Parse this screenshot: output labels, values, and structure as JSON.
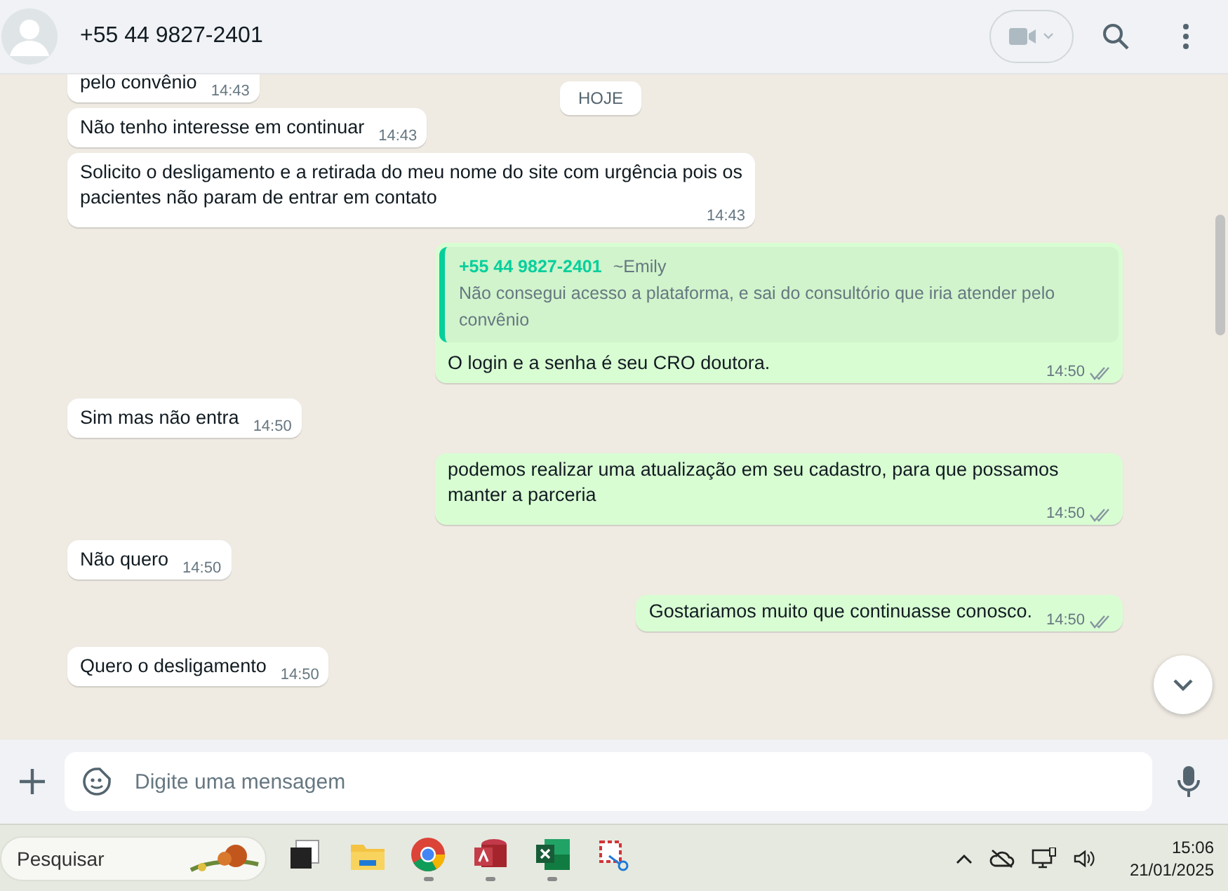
{
  "chat_header": {
    "contact_name": "+55 44 9827-2401"
  },
  "date_chip": "HOJE",
  "messages": [
    {
      "outgoing": false,
      "text": "pelo convênio",
      "time": "14:43"
    },
    {
      "outgoing": false,
      "text": "Não tenho interesse em continuar",
      "time": "14:43"
    },
    {
      "outgoing": false,
      "text": "Solicito o desligamento e a retirada do meu nome do site com urgência pois os pacientes não param de entrar em contato",
      "time": "14:43"
    },
    {
      "outgoing": true,
      "quoted": {
        "author": "+55 44 9827-2401",
        "author_name": "~Emily",
        "text": "Não consegui acesso a plataforma, e sai do consultório que iria atender pelo convênio"
      },
      "text": "O login e a senha é seu CRO doutora.",
      "time": "14:50",
      "read": false
    },
    {
      "outgoing": false,
      "text": "Sim mas não entra",
      "time": "14:50"
    },
    {
      "outgoing": true,
      "text": "podemos realizar uma atualização em seu cadastro, para que possamos manter a parceria",
      "time": "14:50",
      "read": false
    },
    {
      "outgoing": false,
      "text": "Não quero",
      "time": "14:50"
    },
    {
      "outgoing": true,
      "text": "Gostariamos muito que continuasse conosco.",
      "time": "14:50",
      "read": false
    },
    {
      "outgoing": false,
      "text": "Quero o desligamento",
      "time": "14:50"
    }
  ],
  "composer": {
    "placeholder": "Digite uma mensagem"
  },
  "taskbar": {
    "search_placeholder": "Pesquisar",
    "apps": [
      {
        "kind": "taskview",
        "running": false
      },
      {
        "kind": "files",
        "running": false
      },
      {
        "kind": "browser",
        "running": true
      },
      {
        "kind": "database",
        "running": true
      },
      {
        "kind": "spreadsheet",
        "running": true
      },
      {
        "kind": "snip",
        "running": false
      }
    ],
    "time": "15:06",
    "date": "21/01/2025"
  }
}
